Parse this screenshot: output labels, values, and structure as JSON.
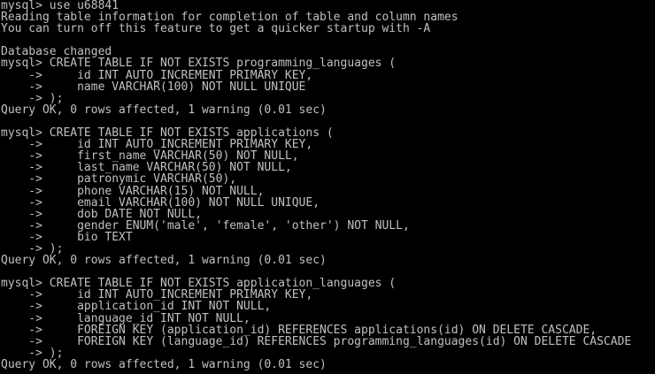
{
  "terminal": {
    "lines": [
      "mysql> use u68841",
      "Reading table information for completion of table and column names",
      "You can turn off this feature to get a quicker startup with -A",
      "",
      "Database changed",
      "mysql> CREATE TABLE IF NOT EXISTS programming_languages (",
      "    ->     id INT AUTO_INCREMENT PRIMARY KEY,",
      "    ->     name VARCHAR(100) NOT NULL UNIQUE",
      "    -> );",
      "Query OK, 0 rows affected, 1 warning (0.01 sec)",
      "",
      "mysql> CREATE TABLE IF NOT EXISTS applications (",
      "    ->     id INT AUTO_INCREMENT PRIMARY KEY,",
      "    ->     first_name VARCHAR(50) NOT NULL,",
      "    ->     last_name VARCHAR(50) NOT NULL,",
      "    ->     patronymic VARCHAR(50),",
      "    ->     phone VARCHAR(15) NOT NULL,",
      "    ->     email VARCHAR(100) NOT NULL UNIQUE,",
      "    ->     dob DATE NOT NULL,",
      "    ->     gender ENUM('male', 'female', 'other') NOT NULL,",
      "    ->     bio TEXT",
      "    -> );",
      "Query OK, 0 rows affected, 1 warning (0.01 sec)",
      "",
      "mysql> CREATE TABLE IF NOT EXISTS application_languages (",
      "    ->     id INT AUTO_INCREMENT PRIMARY KEY,",
      "    ->     application_id INT NOT NULL,",
      "    ->     language_id INT NOT NULL,",
      "    ->     FOREIGN KEY (application_id) REFERENCES applications(id) ON DELETE CASCADE,",
      "    ->     FOREIGN KEY (language_id) REFERENCES programming_languages(id) ON DELETE CASCADE",
      "    -> );",
      "Query OK, 0 rows affected, 1 warning (0.01 sec)"
    ]
  }
}
